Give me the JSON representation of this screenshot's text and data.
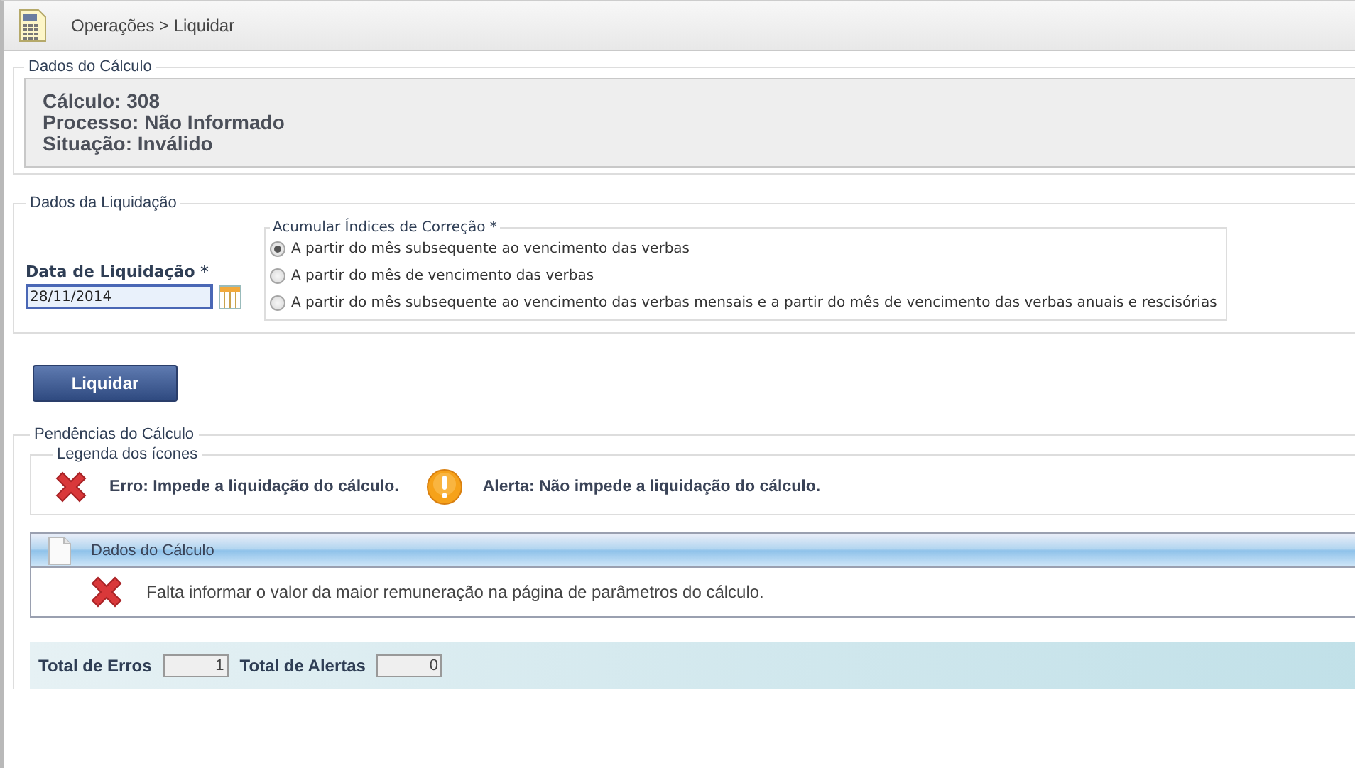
{
  "breadcrumb": "Operações > Liquidar",
  "dados_calculo": {
    "legend": "Dados do Cálculo",
    "lines": [
      "Cálculo: 308",
      "Processo: Não Informado",
      "Situação: Inválido"
    ]
  },
  "dados_liquidacao": {
    "legend": "Dados da Liquidação",
    "date_field": {
      "label": "Data de Liquidação *",
      "value": "28/11/2014"
    },
    "options_group": {
      "legend": "Acumular Índices de Correção *",
      "options": [
        {
          "label": "A partir do mês subsequente ao vencimento das verbas",
          "selected": true
        },
        {
          "label": "A partir do mês de vencimento das verbas",
          "selected": false
        },
        {
          "label": "A partir do mês subsequente ao vencimento das verbas mensais e a partir do mês de vencimento das verbas anuais e rescisórias",
          "selected": false
        }
      ]
    }
  },
  "button": "Liquidar",
  "pendencias": {
    "legend": "Pendências do Cálculo",
    "legenda": {
      "legend": "Legenda dos ícones",
      "items": [
        {
          "kind": "error",
          "text": "Erro: Impede a liquidação do cálculo."
        },
        {
          "kind": "alert",
          "text": "Alerta: Não impede a liquidação do cálculo."
        }
      ]
    },
    "groups": [
      {
        "title": "Dados do Cálculo",
        "items": [
          {
            "kind": "error",
            "text": "Falta informar o valor da maior remuneração na página de parâmetros do cálculo."
          }
        ]
      }
    ],
    "totals": [
      {
        "label": "Total de Erros",
        "value": "1"
      },
      {
        "label": "Total de Alertas",
        "value": "0"
      }
    ]
  }
}
